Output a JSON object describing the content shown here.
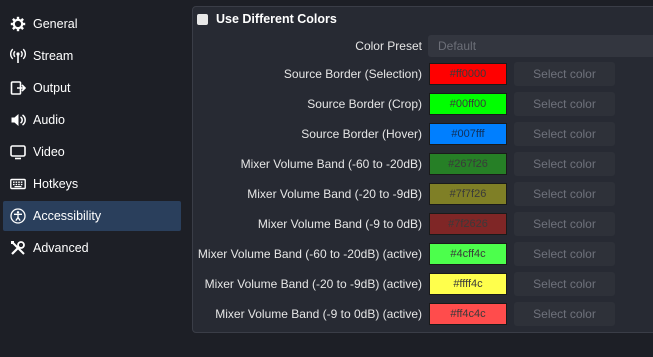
{
  "sidebar": {
    "items": [
      {
        "label": "General",
        "icon": "gear-icon"
      },
      {
        "label": "Stream",
        "icon": "broadcast-icon"
      },
      {
        "label": "Output",
        "icon": "output-icon"
      },
      {
        "label": "Audio",
        "icon": "speaker-icon"
      },
      {
        "label": "Video",
        "icon": "monitor-icon"
      },
      {
        "label": "Hotkeys",
        "icon": "keyboard-icon"
      },
      {
        "label": "Accessibility",
        "icon": "accessibility-icon"
      },
      {
        "label": "Advanced",
        "icon": "tools-icon"
      }
    ],
    "active_index": 6,
    "active_color": "#2a3f5c"
  },
  "options": {
    "use_different_colors_label": "Use Different Colors",
    "color_preset_label": "Color Preset",
    "color_preset_value": "Default"
  },
  "select_color_label": "Select color",
  "colors": [
    {
      "label": "Source Border (Selection)",
      "hex": "#ff0000"
    },
    {
      "label": "Source Border (Crop)",
      "hex": "#00ff00"
    },
    {
      "label": "Source Border (Hover)",
      "hex": "#007fff"
    },
    {
      "label": "Mixer Volume Band (-60 to -20dB)",
      "hex": "#267f26"
    },
    {
      "label": "Mixer Volume Band (-20 to -9dB)",
      "hex": "#7f7f26"
    },
    {
      "label": "Mixer Volume Band (-9 to 0dB)",
      "hex": "#7f2626"
    },
    {
      "label": "Mixer Volume Band (-60 to -20dB) (active)",
      "hex": "#4cff4c"
    },
    {
      "label": "Mixer Volume Band (-20 to -9dB) (active)",
      "hex": "#ffff4c"
    },
    {
      "label": "Mixer Volume Band (-9 to 0dB) (active)",
      "hex": "#ff4c4c"
    }
  ]
}
